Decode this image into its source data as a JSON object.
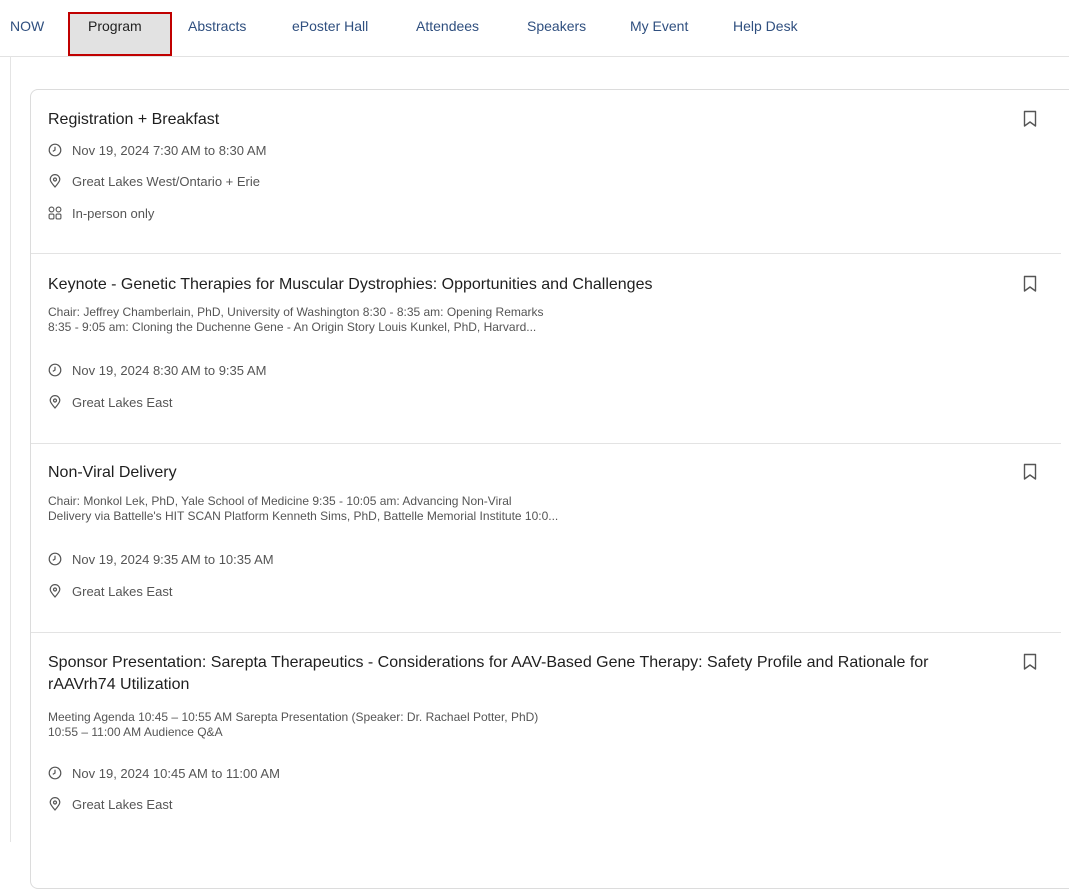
{
  "nav": {
    "items": [
      {
        "label": "NOW"
      },
      {
        "label": "Program"
      },
      {
        "label": "Abstracts"
      },
      {
        "label": "ePoster Hall"
      },
      {
        "label": "Attendees"
      },
      {
        "label": "Speakers"
      },
      {
        "label": "My Event"
      },
      {
        "label": "Help Desk"
      }
    ],
    "active": "Program"
  },
  "sessions": [
    {
      "title": "Registration + Breakfast",
      "time": "Nov 19, 2024 7:30 AM to 8:30 AM",
      "location": "Great Lakes West/Ontario + Erie",
      "format": "In-person only"
    },
    {
      "title": "Keynote - Genetic Therapies for Muscular Dystrophies: Opportunities and Challenges",
      "description": "Chair: Jeffrey Chamberlain, PhD, University of Washington 8:30 - 8:35 am: Opening Remarks\n8:35 - 9:05 am: Cloning the Duchenne Gene - An Origin Story Louis Kunkel, PhD, Harvard...",
      "time": "Nov 19, 2024 8:30 AM to 9:35 AM",
      "location": "Great Lakes East"
    },
    {
      "title": "Non-Viral Delivery",
      "description": "Chair: Monkol Lek, PhD, Yale School of Medicine 9:35 - 10:05 am: Advancing Non-Viral\nDelivery via Battelle's HIT SCAN Platform Kenneth Sims, PhD, Battelle Memorial Institute 10:0...",
      "time": "Nov 19, 2024 9:35 AM to 10:35 AM",
      "location": "Great Lakes East"
    },
    {
      "title": "Sponsor Presentation: Sarepta Therapeutics - Considerations for AAV-Based Gene Therapy: Safety Profile and Rationale for rAAVrh74 Utilization",
      "description": "Meeting Agenda 10:45 – 10:55 AM Sarepta Presentation (Speaker: Dr. Rachael Potter, PhD)\n10:55 – 11:00 AM Audience Q&A",
      "time": "Nov 19, 2024 10:45 AM to 11:00 AM",
      "location": "Great Lakes East"
    }
  ],
  "icons": {
    "time": "clock-icon",
    "location": "location-pin-icon",
    "format": "grid-icon",
    "bookmark": "bookmark-icon"
  },
  "colors": {
    "nav_link": "#2f4f7f",
    "active_outline": "#c00000",
    "active_bg": "#e2e2e2"
  }
}
